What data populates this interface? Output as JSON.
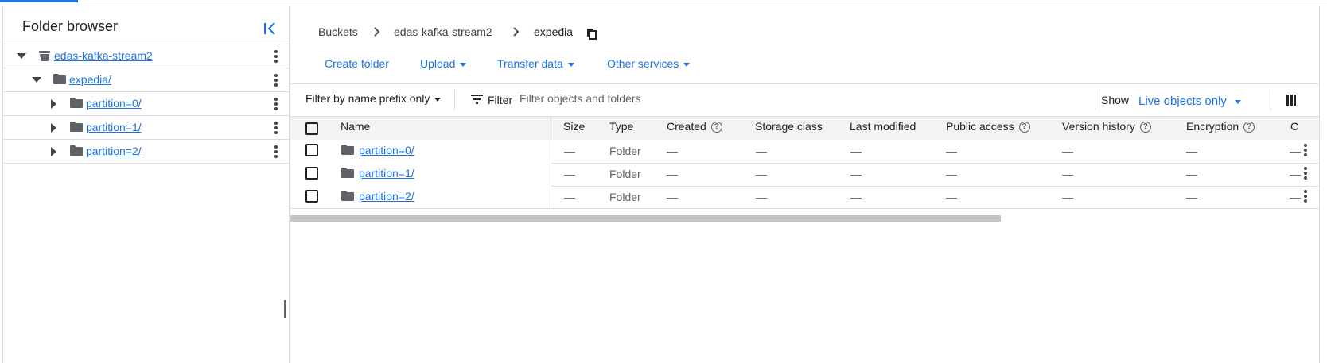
{
  "folder_browser": {
    "title": "Folder browser",
    "tree": [
      {
        "label": "edas-kafka-stream2",
        "expanded": true,
        "icon": "bucket-icon"
      },
      {
        "label": "expedia/",
        "expanded": true,
        "icon": "folder-icon"
      },
      {
        "label": "partition=0/",
        "expanded": false,
        "icon": "folder-icon"
      },
      {
        "label": "partition=1/",
        "expanded": false,
        "icon": "folder-icon"
      },
      {
        "label": "partition=2/",
        "expanded": false,
        "icon": "folder-icon"
      }
    ]
  },
  "breadcrumb": {
    "items": [
      "Buckets",
      "edas-kafka-stream2",
      "expedia"
    ]
  },
  "actions": {
    "create_folder": "Create folder",
    "upload": "Upload",
    "transfer_data": "Transfer data",
    "other_services": "Other services"
  },
  "filter_bar": {
    "prefix_mode": "Filter by name prefix only",
    "filter_label": "Filter",
    "placeholder": "Filter objects and folders",
    "show_label": "Show",
    "show_value": "Live objects only"
  },
  "table": {
    "headers": [
      "Name",
      "Size",
      "Type",
      "Created",
      "Storage class",
      "Last modified",
      "Public access",
      "Version history",
      "Encryption",
      "C"
    ],
    "rows": [
      {
        "name": "partition=0/",
        "size": "—",
        "type": "Folder",
        "created": "—",
        "storage_class": "—",
        "last_modified": "—",
        "public_access": "—",
        "version_history": "—",
        "encryption": "—",
        "extra": "—"
      },
      {
        "name": "partition=1/",
        "size": "—",
        "type": "Folder",
        "created": "—",
        "storage_class": "—",
        "last_modified": "—",
        "public_access": "—",
        "version_history": "—",
        "encryption": "—",
        "extra": "—"
      },
      {
        "name": "partition=2/",
        "size": "—",
        "type": "Folder",
        "created": "—",
        "storage_class": "—",
        "last_modified": "—",
        "public_access": "—",
        "version_history": "—",
        "encryption": "—",
        "extra": "—"
      }
    ]
  },
  "colors": {
    "accent": "#1a73e8",
    "text": "#202124",
    "muted": "#5f6368",
    "border": "#dadce0"
  }
}
